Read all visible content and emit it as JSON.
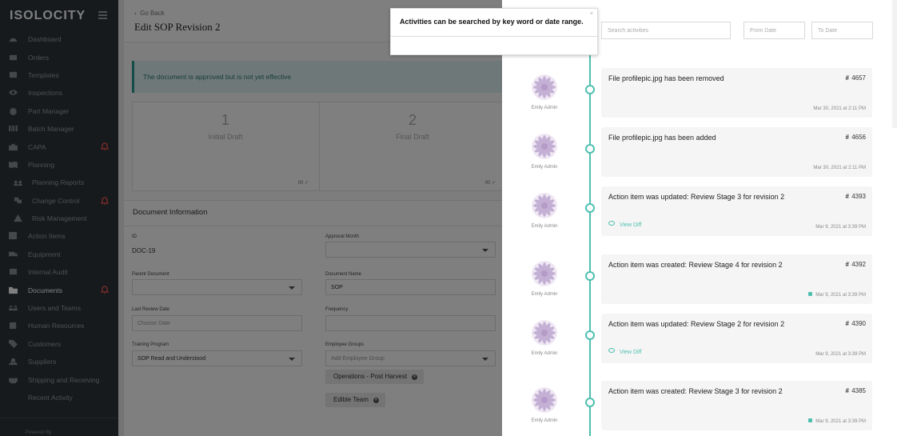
{
  "sidebar": {
    "brand": "ISOLOCITY",
    "items": [
      {
        "label": "Dashboard",
        "icon": "dashboard-icon",
        "sub": false,
        "active": false,
        "alert": false
      },
      {
        "label": "Orders",
        "icon": "orders-icon",
        "sub": false,
        "active": false,
        "alert": false
      },
      {
        "label": "Templates",
        "icon": "templates-icon",
        "sub": false,
        "active": false,
        "alert": false
      },
      {
        "label": "Inspections",
        "icon": "eye-icon",
        "sub": false,
        "active": false,
        "alert": false
      },
      {
        "label": "Part Manager",
        "icon": "gear-icon",
        "sub": false,
        "active": false,
        "alert": false
      },
      {
        "label": "Batch Manager",
        "icon": "barcode-icon",
        "sub": false,
        "active": false,
        "alert": false
      },
      {
        "label": "CAPA",
        "icon": "briefcase-icon",
        "sub": false,
        "active": false,
        "alert": true
      },
      {
        "label": "Planning",
        "icon": "map-icon",
        "sub": false,
        "active": false,
        "alert": false
      },
      {
        "label": "Planning Reports",
        "icon": "people-icon",
        "sub": true,
        "active": false,
        "alert": false
      },
      {
        "label": "Change Control",
        "icon": "change-icon",
        "sub": true,
        "active": false,
        "alert": true
      },
      {
        "label": "Risk Management",
        "icon": "warning-icon",
        "sub": true,
        "active": false,
        "alert": false
      },
      {
        "label": "Action Items",
        "icon": "checkbox-icon",
        "sub": false,
        "active": false,
        "alert": false
      },
      {
        "label": "Equipment",
        "icon": "truck-icon",
        "sub": false,
        "active": false,
        "alert": false
      },
      {
        "label": "Internal Audit",
        "icon": "audit-icon",
        "sub": false,
        "active": false,
        "alert": false
      },
      {
        "label": "Documents",
        "icon": "folder-icon",
        "sub": false,
        "active": true,
        "alert": true
      },
      {
        "label": "Users and Teams",
        "icon": "users-icon",
        "sub": false,
        "active": false,
        "alert": false
      },
      {
        "label": "Human Resources",
        "icon": "book-icon",
        "sub": false,
        "active": false,
        "alert": false
      },
      {
        "label": "Customers",
        "icon": "tag-icon",
        "sub": false,
        "active": false,
        "alert": false
      },
      {
        "label": "Suppliers",
        "icon": "supplier-icon",
        "sub": false,
        "active": false,
        "alert": false
      },
      {
        "label": "Shipping and Receiving",
        "icon": "shipping-icon",
        "sub": false,
        "active": false,
        "alert": false
      },
      {
        "label": "Recent Activity",
        "icon": "",
        "sub": false,
        "active": false,
        "alert": false
      }
    ],
    "powered_by": "Powered By"
  },
  "main": {
    "back_label": "Go Back",
    "title": "Edit SOP Revision 2",
    "alert_text": "The document is approved but is not yet effective",
    "stats": [
      {
        "num": "1",
        "label": "Initial Draft"
      },
      {
        "num": "2",
        "label": "Final Draft"
      }
    ],
    "stat_footer": "00",
    "doc_info": {
      "heading": "Document Information",
      "id_label": "ID",
      "id_value": "DOC-19",
      "approval_month_label": "Approval Month",
      "parent_document_label": "Parent Document",
      "document_name_label": "Document Name",
      "document_name_value": "SOP",
      "last_review_date_label": "Last Review Date",
      "last_review_date_placeholder": "Choose Date",
      "frequency_label": "Frequency",
      "training_program_label": "Training Program",
      "training_program_value": "SOP Read and Understood",
      "employee_groups_label": "Employee Groups",
      "employee_groups_placeholder": "Add Employee Group",
      "chips": [
        "Operations - Post Harvest",
        "Edible Team"
      ]
    }
  },
  "tooltip": {
    "text": "Activities can be searched by key word or date range.",
    "close": "×"
  },
  "activity": {
    "search_placeholder": "Search activities",
    "from_placeholder": "From Date",
    "to_placeholder": "To Date",
    "accent_color": "#4fbfb0",
    "entries": [
      {
        "author": "Emily Admin",
        "text": "File profilepic.jpg has been removed",
        "hash": "#",
        "id": "4657",
        "time": "Mar 30, 2021 at 2:11 PM",
        "link": "",
        "locked": false
      },
      {
        "author": "Emily Admin",
        "text": "File profilepic.jpg has been added",
        "hash": "#",
        "id": "4656",
        "time": "Mar 30, 2021 at 2:11 PM",
        "link": "",
        "locked": false
      },
      {
        "author": "Emily Admin",
        "text": "Action item was updated: Review Stage 3 for revision 2",
        "hash": "#",
        "id": "4393",
        "time": "Mar 9, 2021 at 3:39 PM",
        "link": "View Diff",
        "locked": false
      },
      {
        "author": "Emily Admin",
        "text": "Action item was created: Review Stage 4 for revision 2",
        "hash": "#",
        "id": "4392",
        "time": "Mar 9, 2021 at 3:39 PM",
        "link": "",
        "locked": true
      },
      {
        "author": "Emily Admin",
        "text": "Action item was updated: Review Stage 2 for revision 2",
        "hash": "#",
        "id": "4390",
        "time": "Mar 9, 2021 at 3:39 PM",
        "link": "View Diff",
        "locked": false
      },
      {
        "author": "Emily Admin",
        "text": "Action item was created: Review Stage 3 for revision 2",
        "hash": "#",
        "id": "4385",
        "time": "Mar 9, 2021 at 3:39 PM",
        "link": "",
        "locked": true
      }
    ]
  }
}
